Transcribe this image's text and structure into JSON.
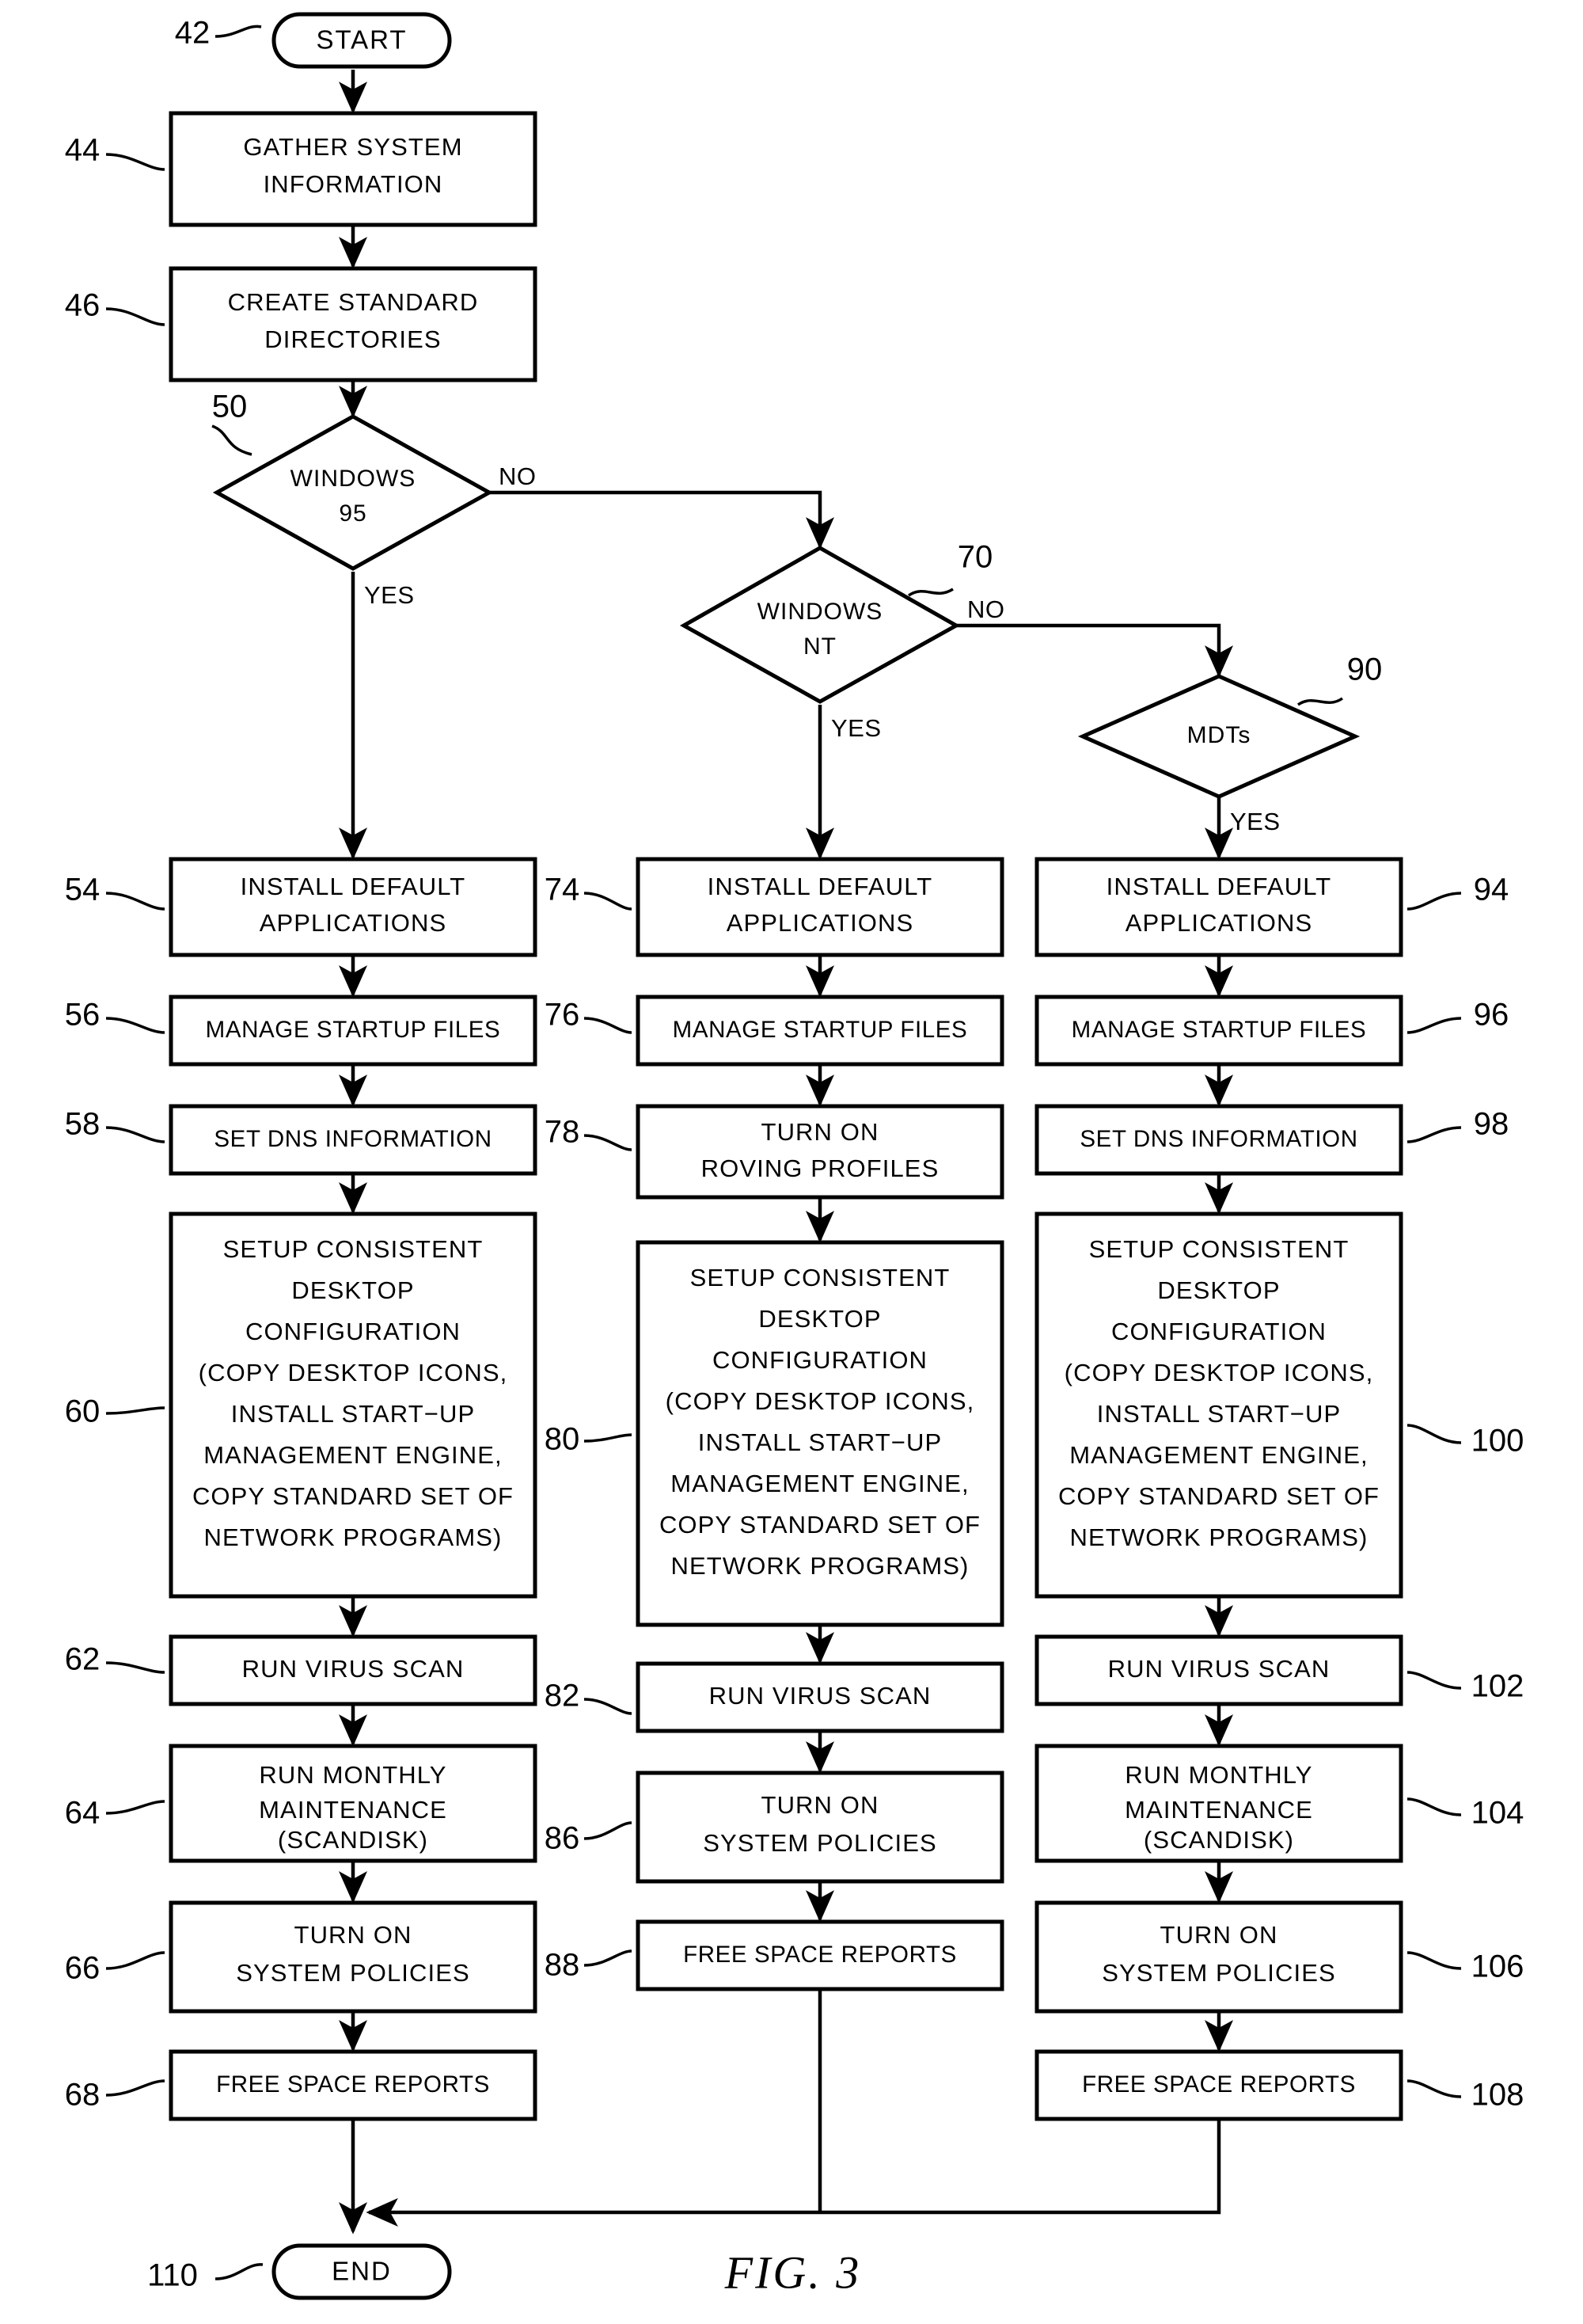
{
  "figure": {
    "caption": "FIG.  3",
    "type": "patent-flowchart"
  },
  "terminators": {
    "start": {
      "label": "START",
      "ref": "42"
    },
    "end": {
      "label": "END",
      "ref": "110"
    }
  },
  "common_steps": [
    {
      "ref": "44",
      "lines": [
        "GATHER SYSTEM",
        "INFORMATION"
      ]
    },
    {
      "ref": "46",
      "lines": [
        "CREATE STANDARD",
        "DIRECTORIES"
      ]
    }
  ],
  "decisions": [
    {
      "ref": "50",
      "lines": [
        "WINDOWS",
        "95"
      ],
      "yes_label": "YES",
      "no_label": "NO"
    },
    {
      "ref": "70",
      "lines": [
        "WINDOWS",
        "NT"
      ],
      "yes_label": "YES",
      "no_label": "NO"
    },
    {
      "ref": "90",
      "lines": [
        "MDTs"
      ],
      "yes_label": "YES"
    }
  ],
  "branches": [
    {
      "name": "windows-95-branch",
      "steps": [
        {
          "ref": "54",
          "lines": [
            "INSTALL DEFAULT",
            "APPLICATIONS"
          ]
        },
        {
          "ref": "56",
          "lines": [
            "MANAGE STARTUP FILES"
          ]
        },
        {
          "ref": "58",
          "lines": [
            "SET DNS INFORMATION"
          ]
        },
        {
          "ref": "60",
          "lines": [
            "SETUP CONSISTENT",
            "DESKTOP",
            "CONFIGURATION",
            "(COPY DESKTOP ICONS,",
            "INSTALL START−UP",
            "MANAGEMENT ENGINE,",
            "COPY STANDARD SET OF",
            "NETWORK PROGRAMS)"
          ]
        },
        {
          "ref": "62",
          "lines": [
            "RUN VIRUS SCAN"
          ]
        },
        {
          "ref": "64",
          "lines": [
            "RUN MONTHLY",
            "MAINTENANCE",
            "(SCANDISK)"
          ]
        },
        {
          "ref": "66",
          "lines": [
            "TURN ON",
            "SYSTEM POLICIES"
          ]
        },
        {
          "ref": "68",
          "lines": [
            "FREE SPACE REPORTS"
          ]
        }
      ]
    },
    {
      "name": "windows-nt-branch",
      "steps": [
        {
          "ref": "74",
          "lines": [
            "INSTALL DEFAULT",
            "APPLICATIONS"
          ]
        },
        {
          "ref": "76",
          "lines": [
            "MANAGE STARTUP FILES"
          ]
        },
        {
          "ref": "78",
          "lines": [
            "TURN ON",
            "ROVING PROFILES"
          ]
        },
        {
          "ref": "80",
          "lines": [
            "SETUP CONSISTENT",
            "DESKTOP",
            "CONFIGURATION",
            "(COPY DESKTOP ICONS,",
            "INSTALL START−UP",
            "MANAGEMENT ENGINE,",
            "COPY STANDARD SET OF",
            "NETWORK PROGRAMS)"
          ]
        },
        {
          "ref": "82",
          "lines": [
            "RUN VIRUS SCAN"
          ]
        },
        {
          "ref": "86",
          "lines": [
            "TURN ON",
            "SYSTEM POLICIES"
          ]
        },
        {
          "ref": "88",
          "lines": [
            "FREE SPACE REPORTS"
          ]
        }
      ]
    },
    {
      "name": "mdts-branch",
      "steps": [
        {
          "ref": "94",
          "lines": [
            "INSTALL DEFAULT",
            "APPLICATIONS"
          ]
        },
        {
          "ref": "96",
          "lines": [
            "MANAGE STARTUP FILES"
          ]
        },
        {
          "ref": "98",
          "lines": [
            "SET DNS INFORMATION"
          ]
        },
        {
          "ref": "100",
          "lines": [
            "SETUP CONSISTENT",
            "DESKTOP",
            "CONFIGURATION",
            "(COPY DESKTOP ICONS,",
            "INSTALL START−UP",
            "MANAGEMENT ENGINE,",
            "COPY STANDARD SET OF",
            "NETWORK PROGRAMS)"
          ]
        },
        {
          "ref": "102",
          "lines": [
            "RUN VIRUS SCAN"
          ]
        },
        {
          "ref": "104",
          "lines": [
            "RUN MONTHLY",
            "MAINTENANCE",
            "(SCANDISK)"
          ]
        },
        {
          "ref": "106",
          "lines": [
            "TURN ON",
            "SYSTEM POLICIES"
          ]
        },
        {
          "ref": "108",
          "lines": [
            "FREE SPACE REPORTS"
          ]
        }
      ]
    }
  ],
  "colors": {
    "ink": "#000000",
    "paper": "#ffffff"
  }
}
